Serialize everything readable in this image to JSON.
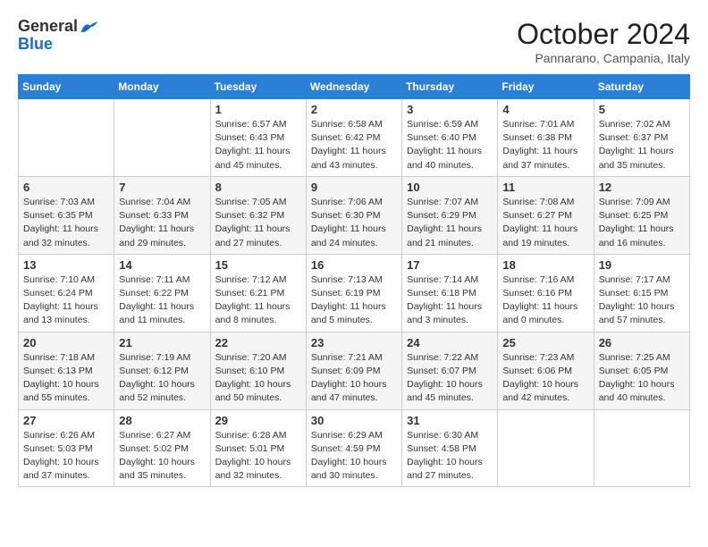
{
  "header": {
    "logo_general": "General",
    "logo_blue": "Blue",
    "month_title": "October 2024",
    "location": "Pannarano, Campania, Italy"
  },
  "weekdays": [
    "Sunday",
    "Monday",
    "Tuesday",
    "Wednesday",
    "Thursday",
    "Friday",
    "Saturday"
  ],
  "weeks": [
    [
      {
        "day": "",
        "info": ""
      },
      {
        "day": "",
        "info": ""
      },
      {
        "day": "1",
        "info": "Sunrise: 6:57 AM\nSunset: 6:43 PM\nDaylight: 11 hours and 45 minutes."
      },
      {
        "day": "2",
        "info": "Sunrise: 6:58 AM\nSunset: 6:42 PM\nDaylight: 11 hours and 43 minutes."
      },
      {
        "day": "3",
        "info": "Sunrise: 6:59 AM\nSunset: 6:40 PM\nDaylight: 11 hours and 40 minutes."
      },
      {
        "day": "4",
        "info": "Sunrise: 7:01 AM\nSunset: 6:38 PM\nDaylight: 11 hours and 37 minutes."
      },
      {
        "day": "5",
        "info": "Sunrise: 7:02 AM\nSunset: 6:37 PM\nDaylight: 11 hours and 35 minutes."
      }
    ],
    [
      {
        "day": "6",
        "info": "Sunrise: 7:03 AM\nSunset: 6:35 PM\nDaylight: 11 hours and 32 minutes."
      },
      {
        "day": "7",
        "info": "Sunrise: 7:04 AM\nSunset: 6:33 PM\nDaylight: 11 hours and 29 minutes."
      },
      {
        "day": "8",
        "info": "Sunrise: 7:05 AM\nSunset: 6:32 PM\nDaylight: 11 hours and 27 minutes."
      },
      {
        "day": "9",
        "info": "Sunrise: 7:06 AM\nSunset: 6:30 PM\nDaylight: 11 hours and 24 minutes."
      },
      {
        "day": "10",
        "info": "Sunrise: 7:07 AM\nSunset: 6:29 PM\nDaylight: 11 hours and 21 minutes."
      },
      {
        "day": "11",
        "info": "Sunrise: 7:08 AM\nSunset: 6:27 PM\nDaylight: 11 hours and 19 minutes."
      },
      {
        "day": "12",
        "info": "Sunrise: 7:09 AM\nSunset: 6:25 PM\nDaylight: 11 hours and 16 minutes."
      }
    ],
    [
      {
        "day": "13",
        "info": "Sunrise: 7:10 AM\nSunset: 6:24 PM\nDaylight: 11 hours and 13 minutes."
      },
      {
        "day": "14",
        "info": "Sunrise: 7:11 AM\nSunset: 6:22 PM\nDaylight: 11 hours and 11 minutes."
      },
      {
        "day": "15",
        "info": "Sunrise: 7:12 AM\nSunset: 6:21 PM\nDaylight: 11 hours and 8 minutes."
      },
      {
        "day": "16",
        "info": "Sunrise: 7:13 AM\nSunset: 6:19 PM\nDaylight: 11 hours and 5 minutes."
      },
      {
        "day": "17",
        "info": "Sunrise: 7:14 AM\nSunset: 6:18 PM\nDaylight: 11 hours and 3 minutes."
      },
      {
        "day": "18",
        "info": "Sunrise: 7:16 AM\nSunset: 6:16 PM\nDaylight: 11 hours and 0 minutes."
      },
      {
        "day": "19",
        "info": "Sunrise: 7:17 AM\nSunset: 6:15 PM\nDaylight: 10 hours and 57 minutes."
      }
    ],
    [
      {
        "day": "20",
        "info": "Sunrise: 7:18 AM\nSunset: 6:13 PM\nDaylight: 10 hours and 55 minutes."
      },
      {
        "day": "21",
        "info": "Sunrise: 7:19 AM\nSunset: 6:12 PM\nDaylight: 10 hours and 52 minutes."
      },
      {
        "day": "22",
        "info": "Sunrise: 7:20 AM\nSunset: 6:10 PM\nDaylight: 10 hours and 50 minutes."
      },
      {
        "day": "23",
        "info": "Sunrise: 7:21 AM\nSunset: 6:09 PM\nDaylight: 10 hours and 47 minutes."
      },
      {
        "day": "24",
        "info": "Sunrise: 7:22 AM\nSunset: 6:07 PM\nDaylight: 10 hours and 45 minutes."
      },
      {
        "day": "25",
        "info": "Sunrise: 7:23 AM\nSunset: 6:06 PM\nDaylight: 10 hours and 42 minutes."
      },
      {
        "day": "26",
        "info": "Sunrise: 7:25 AM\nSunset: 6:05 PM\nDaylight: 10 hours and 40 minutes."
      }
    ],
    [
      {
        "day": "27",
        "info": "Sunrise: 6:26 AM\nSunset: 5:03 PM\nDaylight: 10 hours and 37 minutes."
      },
      {
        "day": "28",
        "info": "Sunrise: 6:27 AM\nSunset: 5:02 PM\nDaylight: 10 hours and 35 minutes."
      },
      {
        "day": "29",
        "info": "Sunrise: 6:28 AM\nSunset: 5:01 PM\nDaylight: 10 hours and 32 minutes."
      },
      {
        "day": "30",
        "info": "Sunrise: 6:29 AM\nSunset: 4:59 PM\nDaylight: 10 hours and 30 minutes."
      },
      {
        "day": "31",
        "info": "Sunrise: 6:30 AM\nSunset: 4:58 PM\nDaylight: 10 hours and 27 minutes."
      },
      {
        "day": "",
        "info": ""
      },
      {
        "day": "",
        "info": ""
      }
    ]
  ]
}
